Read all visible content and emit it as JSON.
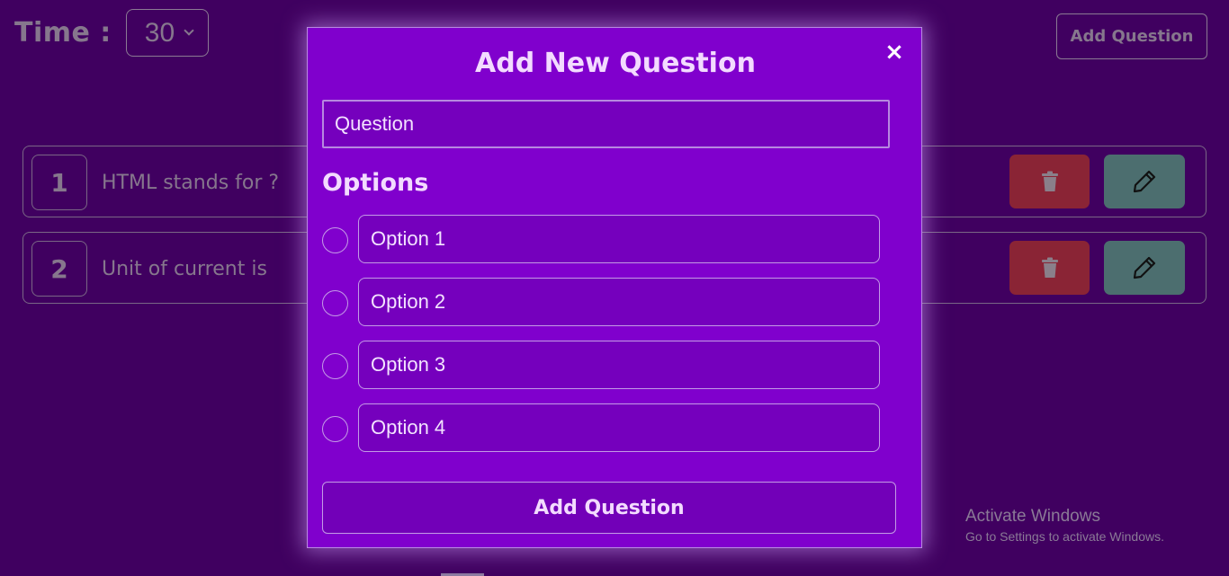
{
  "header": {
    "time_label": "Time :",
    "time_select_value": "30",
    "add_question_label": "Add Question"
  },
  "questions": [
    {
      "number": "1",
      "text": "HTML stands for ?"
    },
    {
      "number": "2",
      "text": "Unit of current is"
    }
  ],
  "modal": {
    "title": "Add New Question",
    "close_glyph": "×",
    "question_placeholder": "Question",
    "options_heading": "Options",
    "options": [
      {
        "placeholder": "Option 1"
      },
      {
        "placeholder": "Option 2"
      },
      {
        "placeholder": "Option 3"
      },
      {
        "placeholder": "Option 4"
      }
    ],
    "submit_label": "Add Question"
  },
  "watermark": {
    "title": "Activate Windows",
    "subtitle": "Go to Settings to activate Windows."
  },
  "icons": {
    "delete": "trash-icon",
    "edit": "pencil-icon",
    "close": "close-icon",
    "dropdown": "chevron-down-icon"
  },
  "colors": {
    "page_background": "#400060",
    "modal_background": "#8000cd",
    "delete_button": "#8a2435",
    "edit_button": "#4c6e6f",
    "modal_text": "#f3dbff"
  }
}
